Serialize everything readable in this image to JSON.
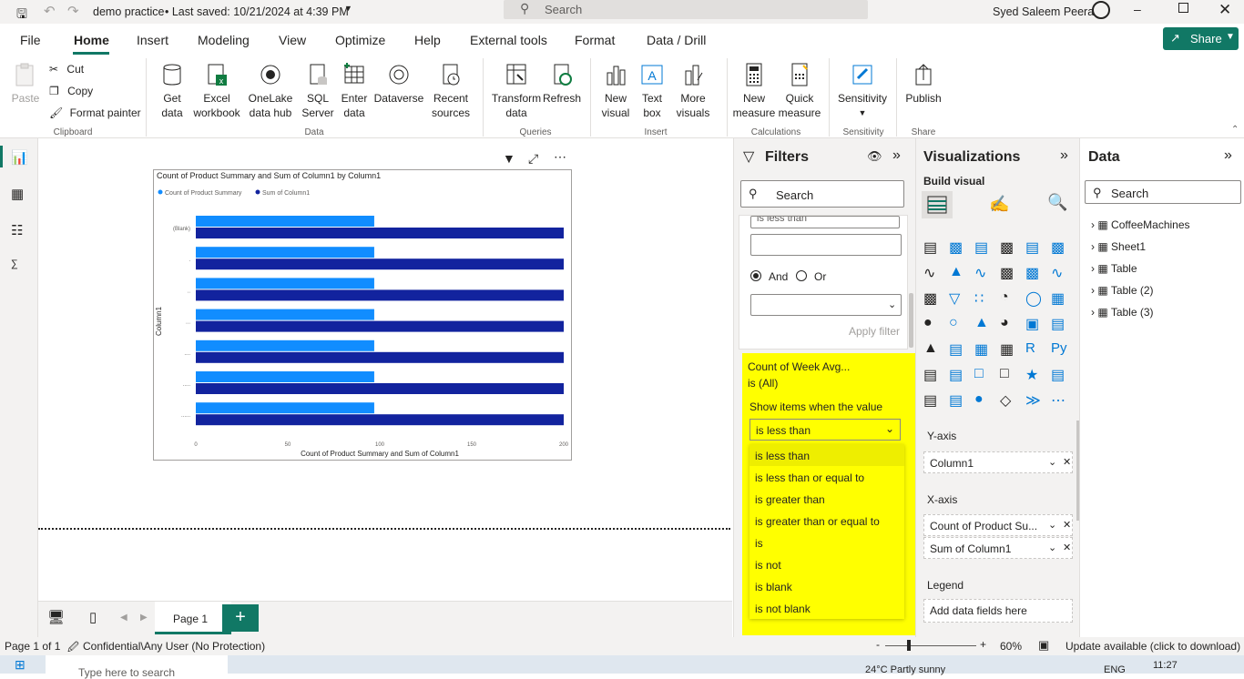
{
  "titlebar": {
    "doc": "demo practice",
    "saved": "• Last saved: 10/21/2024 at 4:39 PM",
    "search": "Search",
    "user": "Syed Saleem Peera"
  },
  "tabs": [
    "File",
    "Home",
    "Insert",
    "Modeling",
    "View",
    "Optimize",
    "Help",
    "External tools",
    "Format",
    "Data / Drill"
  ],
  "share": "Share",
  "ribbon": {
    "paste": "Paste",
    "cut": "Cut",
    "copy": "Copy",
    "format_painter": "Format painter",
    "get_data": "Get data",
    "excel": "Excel workbook",
    "onelake": "OneLake data hub",
    "sql": "SQL Server",
    "enter": "Enter data",
    "dataverse": "Dataverse",
    "recent": "Recent sources",
    "transform": "Transform data",
    "refresh": "Refresh",
    "new_visual": "New visual",
    "text_box": "Text box",
    "more_visuals": "More visuals",
    "new_measure": "New measure",
    "quick_measure": "Quick measure",
    "sensitivity": "Sensitivity",
    "publish": "Publish",
    "groups": [
      "Clipboard",
      "Data",
      "Queries",
      "Insert",
      "Calculations",
      "Sensitivity",
      "Share"
    ]
  },
  "chart_data": {
    "type": "bar",
    "title": "Count of Product Summary and Sum of Column1 by Column1",
    "categories": [
      "(Blank)",
      ".",
      "..",
      "...",
      "....",
      ".....",
      "......"
    ],
    "series": [
      {
        "name": "Count of Product Summary",
        "values": [
          97,
          97,
          97,
          97,
          97,
          97,
          97
        ],
        "color": "#118dff"
      },
      {
        "name": "Sum of Column1",
        "values": [
          200,
          200,
          200,
          200,
          200,
          200,
          200
        ],
        "color": "#12239e"
      }
    ],
    "xlabel": "Count of Product Summary and Sum of Column1",
    "ylabel": "Column1",
    "xticks": [
      "0",
      "50",
      "100",
      "150",
      "200"
    ],
    "xlim": [
      0,
      200
    ]
  },
  "filters": {
    "title": "Filters",
    "search": "Search",
    "cond_top": "is less than",
    "and": "And",
    "or": "Or",
    "apply": "Apply filter",
    "card_title": "Count of Week Avg...",
    "card_sub": "is (All)",
    "show_items": "Show items when the value",
    "selected": "is less than",
    "options": [
      "is less than",
      "is less than or equal to",
      "is greater than",
      "is greater than or equal to",
      "is",
      "is not",
      "is blank",
      "is not blank"
    ]
  },
  "viz": {
    "title": "Visualizations",
    "build": "Build visual",
    "yaxis": "Y-axis",
    "yfield": "Column1",
    "xaxis": "X-axis",
    "xfield1": "Count of Product Su...",
    "xfield2": "Sum of Column1",
    "legend": "Legend",
    "legend_add": "Add data fields here"
  },
  "data": {
    "title": "Data",
    "search": "Search",
    "tables": [
      "CoffeeMachines",
      "Sheet1",
      "Table",
      "Table (2)",
      "Table (3)"
    ]
  },
  "pages": {
    "tab": "Page 1"
  },
  "status": {
    "page": "Page 1 of 1",
    "sensitivity": "Confidential\\Any User (No Protection)",
    "zoom": "60%",
    "update": "Update available (click to download)"
  },
  "taskbar": {
    "search": "Type here to search",
    "time": "11:27",
    "weather": "24°C  Partly sunny",
    "lang": "ENG"
  }
}
